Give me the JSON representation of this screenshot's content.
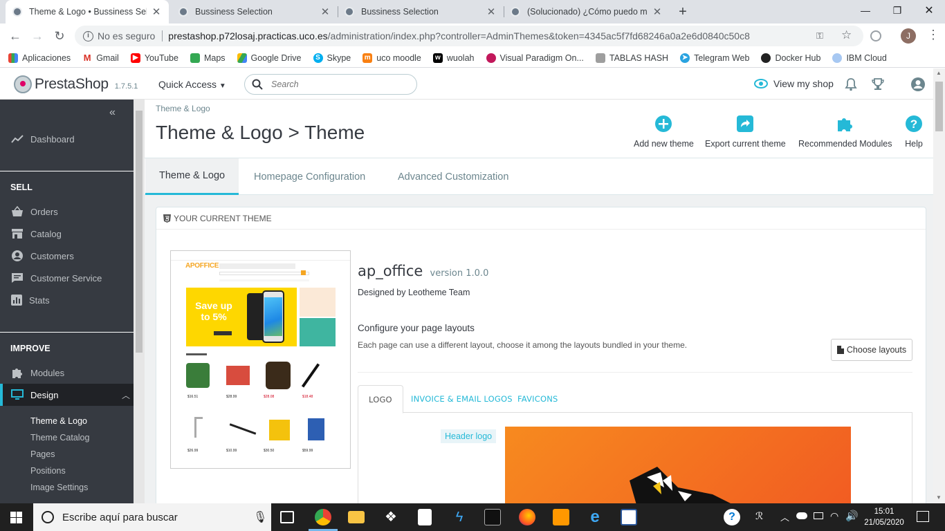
{
  "browser": {
    "tabs": [
      {
        "title": "Theme & Logo • Bussiness Selection"
      },
      {
        "title": "Bussiness Selection"
      },
      {
        "title": "Bussiness Selection"
      },
      {
        "title": "(Solucionado) ¿Cómo puedo mod"
      }
    ],
    "security": "No es seguro",
    "url_host": "prestashop.p72losaj.practicas.uco.es",
    "url_path": "/administration/index.php?controller=AdminThemes&token=4345ac5f7fd68246a0a2e6d0840c50c8",
    "profile_initial": "J",
    "bookmarks": [
      "Aplicaciones",
      "Gmail",
      "YouTube",
      "Maps",
      "Google Drive",
      "Skype",
      "uco moodle",
      "wuolah",
      "Visual Paradigm On...",
      "TABLAS HASH",
      "Telegram Web",
      "Docker Hub",
      "IBM Cloud"
    ]
  },
  "header": {
    "brand": "PrestaShop",
    "version": "1.7.5.1",
    "quick_access": "Quick Access",
    "search_placeholder": "Search",
    "view_shop": "View my shop"
  },
  "sidebar": {
    "dashboard": "Dashboard",
    "sell_title": "SELL",
    "sell_items": [
      "Orders",
      "Catalog",
      "Customers",
      "Customer Service",
      "Stats"
    ],
    "improve_title": "IMPROVE",
    "modules": "Modules",
    "design": "Design",
    "design_sub": [
      "Theme & Logo",
      "Theme Catalog",
      "Pages",
      "Positions",
      "Image Settings"
    ]
  },
  "page": {
    "breadcrumb": "Theme & Logo",
    "title": "Theme & Logo > Theme",
    "toolbar": [
      "Add new theme",
      "Export current theme",
      "Recommended Modules",
      "Help"
    ],
    "tabs": [
      "Theme & Logo",
      "Homepage Configuration",
      "Advanced Customization"
    ],
    "panel_title": "YOUR CURRENT THEME",
    "theme_name": "ap_office",
    "theme_version": "version 1.0.0",
    "designed_by": "Designed by Leotheme Team",
    "configure_title": "Configure your page layouts",
    "configure_desc": "Each page can use a different layout, choose it among the layouts bundled in your theme.",
    "choose_layouts": "Choose layouts",
    "logo_tabs": [
      "LOGO",
      "INVOICE & EMAIL LOGOS",
      "FAVICONS"
    ],
    "header_logo_label": "Header logo"
  },
  "preview": {
    "brand": "APOFFICE",
    "banner_line1": "Save up",
    "banner_line2": "to 5%",
    "prices": [
      "$16.51",
      "$28.99",
      "$28.08",
      "$18.48",
      "$26.99",
      "$10.99",
      "$30.50",
      "$59.99"
    ]
  },
  "taskbar": {
    "search_placeholder": "Escribe aquí para buscar",
    "time": "15:01",
    "date": "21/05/2020"
  },
  "colors": {
    "accent": "#25b9d7",
    "sidebar": "#363a41",
    "pink": "#df0067"
  }
}
